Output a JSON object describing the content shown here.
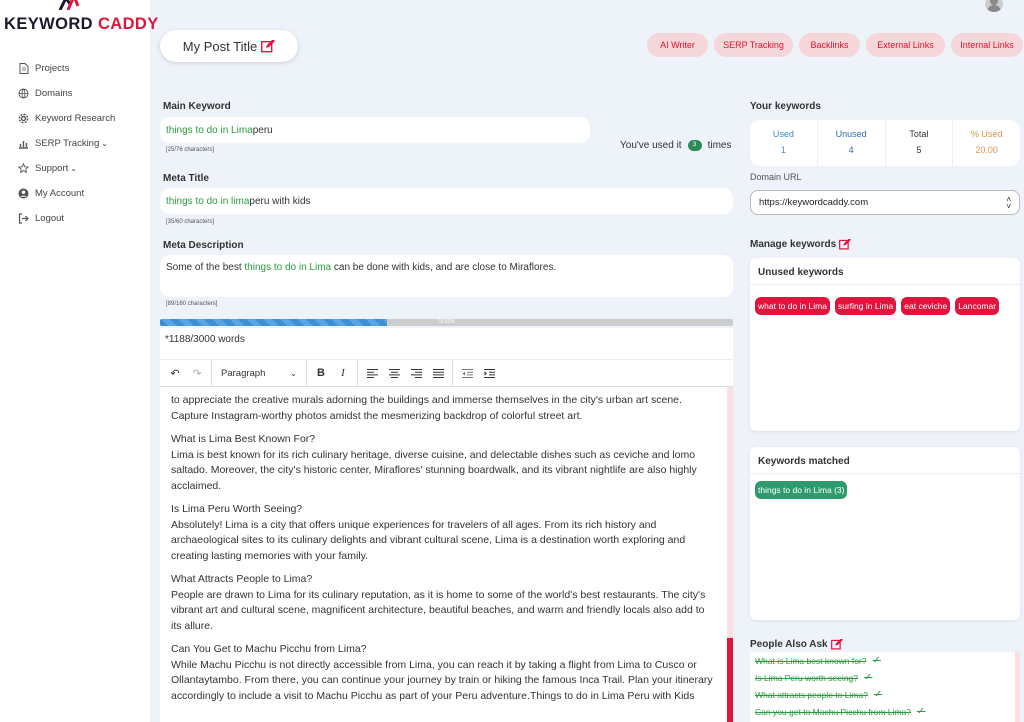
{
  "brand": {
    "name_part1": "KEYWORD ",
    "name_part2": "CADDY"
  },
  "sidebar": {
    "items": [
      {
        "label": "Projects",
        "icon": "document-icon"
      },
      {
        "label": "Domains",
        "icon": "globe-icon"
      },
      {
        "label": "Keyword Research",
        "icon": "gear-icon"
      },
      {
        "label": "SERP Tracking",
        "icon": "chart-icon",
        "has_submenu": true
      },
      {
        "label": "Support",
        "icon": "star-icon",
        "has_submenu": true
      },
      {
        "label": "My Account",
        "icon": "user-icon"
      },
      {
        "label": "Logout",
        "icon": "logout-icon"
      }
    ]
  },
  "header": {
    "post_title": "My Post Title",
    "tabs": [
      "AI Writer",
      "SERP Tracking",
      "Backlinks",
      "External Links",
      "Internal Links"
    ]
  },
  "main_keyword": {
    "label": "Main Keyword",
    "value_kw": "things to do in Lima",
    "value_rest": " peru",
    "char_count": "[25/76 characters]",
    "used_prefix": "You've used it",
    "used_count": "3",
    "used_suffix": "times"
  },
  "meta_title": {
    "label": "Meta Title",
    "value_kw": "things to do in lima",
    "value_rest": " peru with kids",
    "char_count": "[35/60 characters]"
  },
  "meta_description": {
    "label": "Meta Description",
    "value_pre": "Some of the best ",
    "value_kw": "things to do in Lima",
    "value_post": " can be done with kids, and are close to Miraflores.",
    "char_count": "[89/160 characters]"
  },
  "progress": {
    "percent": 39.6,
    "label": "39.60%"
  },
  "editor": {
    "word_count": "*1188/3000 words",
    "block_format": "Paragraph",
    "paragraphs": [
      {
        "heading": "",
        "text": "to appreciate the creative murals adorning the buildings and immerse themselves in the city's urban art scene. Capture Instagram-worthy photos amidst the mesmerizing backdrop of colorful street art."
      },
      {
        "heading": "What is Lima Best Known For?",
        "text": "Lima is best known for its rich culinary heritage, diverse cuisine, and delectable dishes such as ceviche and lomo saltado. Moreover, the city's historic center, Miraflores' stunning boardwalk, and its vibrant nightlife are also highly acclaimed."
      },
      {
        "heading": "Is Lima Peru Worth Seeing?",
        "text": "Absolutely! Lima is a city that offers unique experiences for travelers of all ages. From its rich history and archaeological sites to its culinary delights and vibrant cultural scene, Lima is a destination worth exploring and creating lasting memories with your family."
      },
      {
        "heading": "What Attracts People to Lima?",
        "text": "People are drawn to Lima for its culinary reputation, as it is home to some of the world's best restaurants. The city's vibrant art and cultural scene, magnificent architecture, beautiful beaches, and warm and friendly locals also add to its allure."
      },
      {
        "heading": "Can You Get to Machu Picchu from Lima?",
        "text": "While Machu Picchu is not directly accessible from Lima, you can reach it by taking a flight from Lima to Cusco or Ollantaytambo. From there, you can continue your journey by train or hiking the famous Inca Trail. Plan your itinerary accordingly to include a visit to Machu Picchu as part of your Peru adventure.Things to do in Lima Peru with Kids"
      }
    ]
  },
  "your_keywords": {
    "label": "Your keywords",
    "columns": [
      {
        "name": "Used",
        "value": "1",
        "color": "#3a8fd0"
      },
      {
        "name": "Unused",
        "value": "4",
        "color": "#2e6db0"
      },
      {
        "name": "Total",
        "value": "5",
        "color": "#333333"
      },
      {
        "name": "% Used",
        "value": "20.00",
        "color": "#d9954a"
      }
    ]
  },
  "domain": {
    "label": "Domain URL",
    "value": "https://keywordcaddy.com"
  },
  "manage_keywords": {
    "label": "Manage keywords"
  },
  "unused_keywords": {
    "label": "Unused keywords",
    "items": [
      "what to do in Lima",
      "surfing in Lima",
      "eat ceviche",
      "Lancomar"
    ]
  },
  "keywords_matched": {
    "label": "Keywords matched",
    "items": [
      "things to do in Lima (3)"
    ]
  },
  "people_also_ask": {
    "label": "People Also Ask",
    "items": [
      "What is Lima best known for?",
      "Is Lima Peru worth seeing?",
      "What attracts people to Lima?",
      "Can you get to Machu Picchu from Lima?"
    ]
  }
}
